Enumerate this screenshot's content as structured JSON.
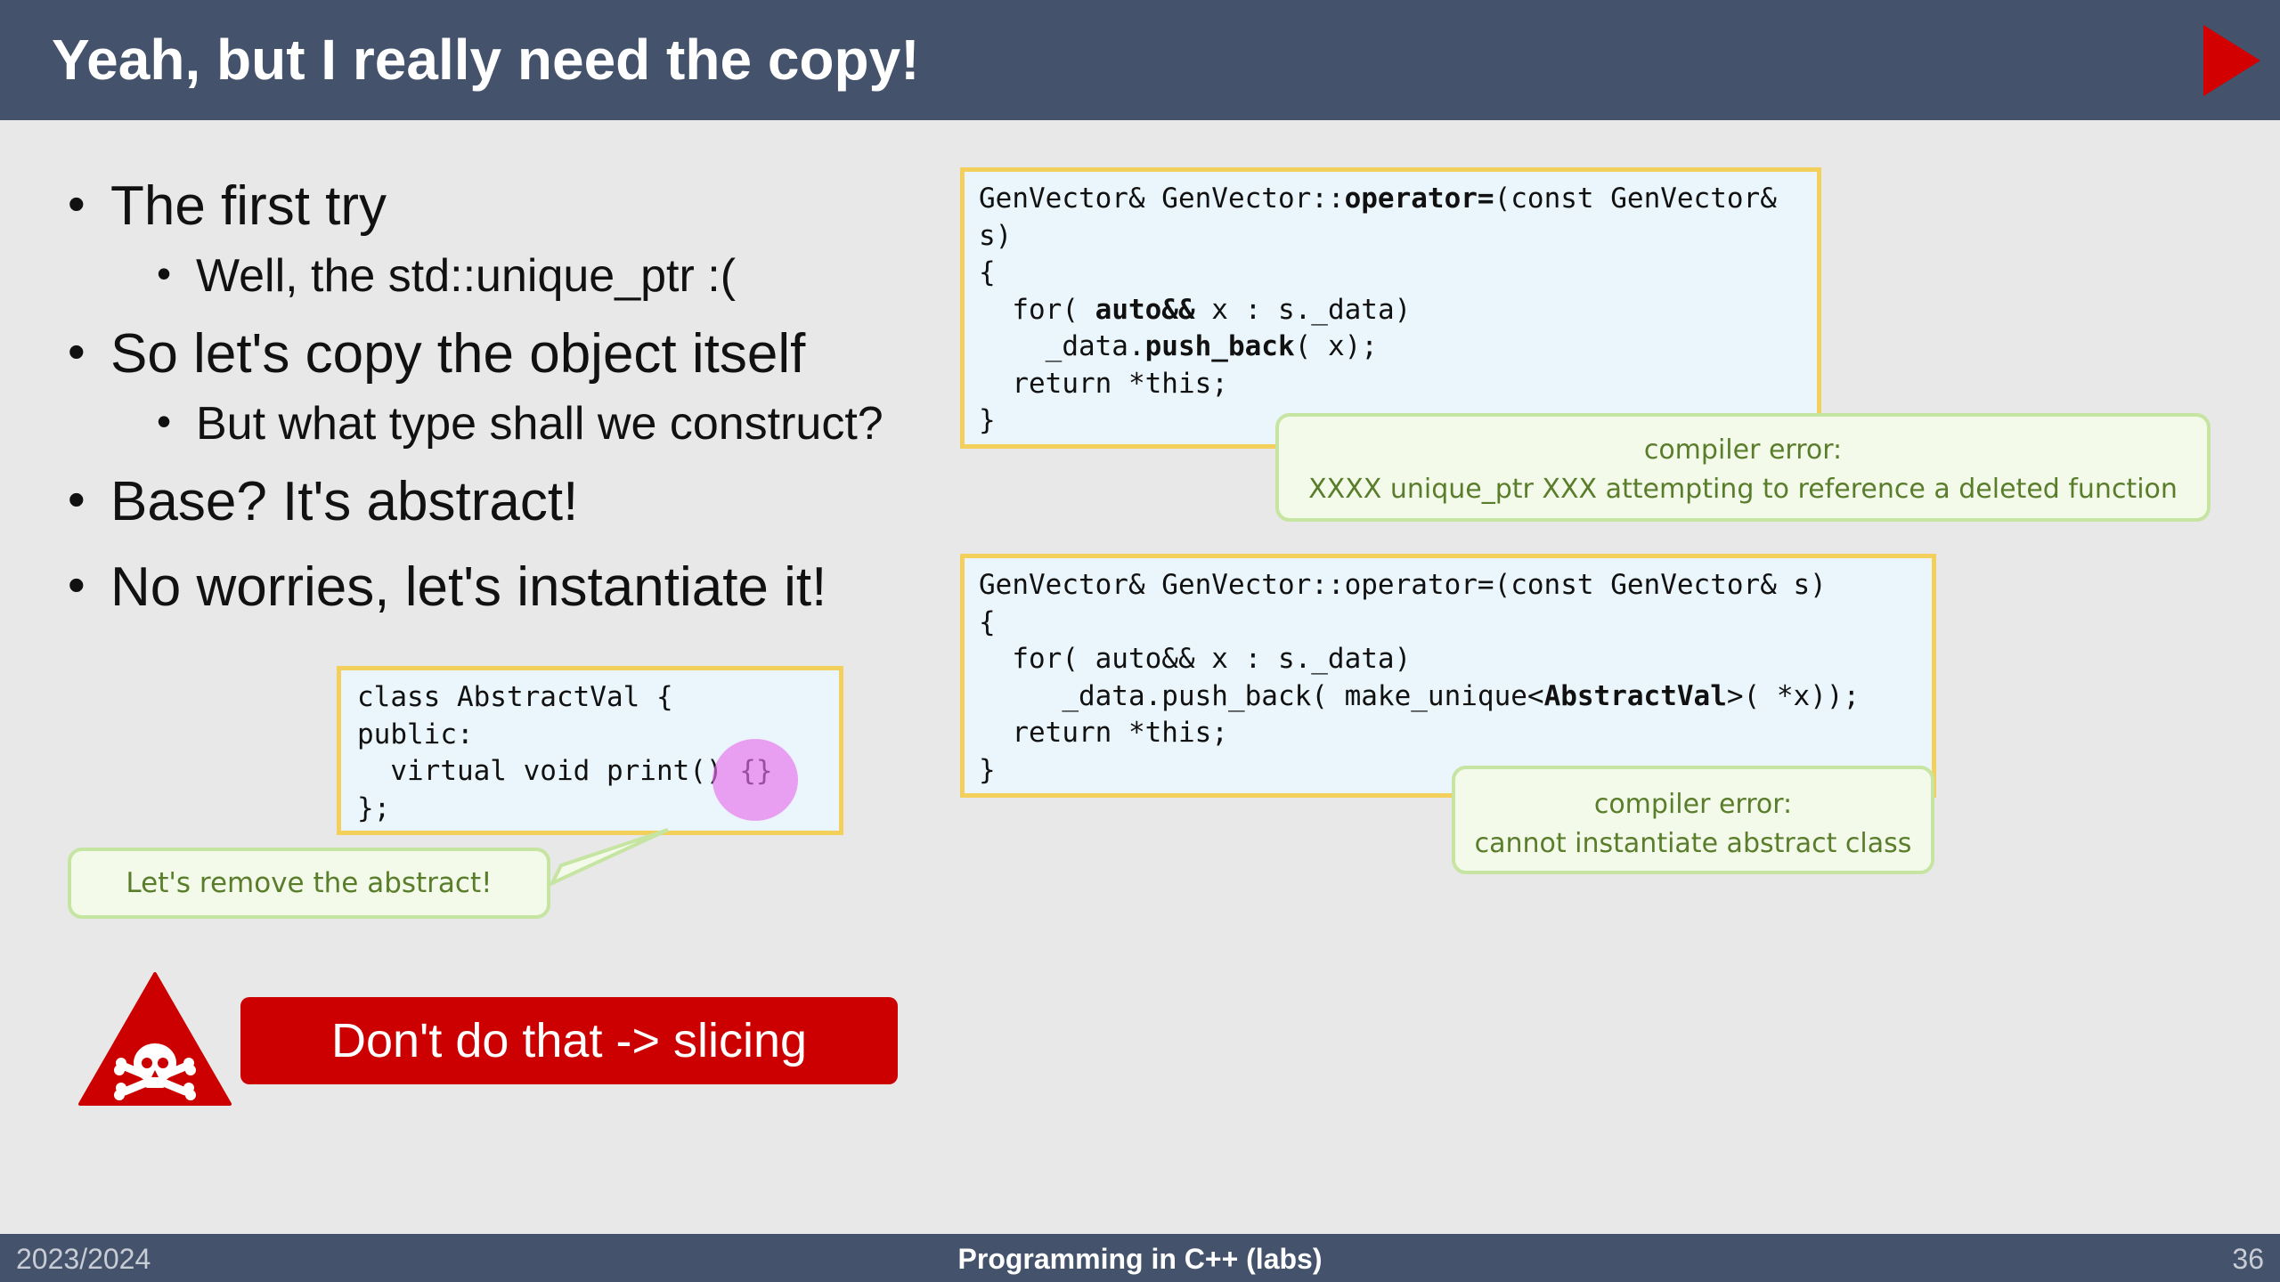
{
  "header": {
    "title": "Yeah, but I really need the copy!",
    "nav_icon": "play-triangle-icon",
    "accent_color": "#d20000",
    "bar_color": "#44536b"
  },
  "bullets": [
    {
      "text": "The first try",
      "level": 1
    },
    {
      "text": "Well, the std::unique_ptr :(",
      "level": 2
    },
    {
      "text": "So let's copy the object itself",
      "level": 1
    },
    {
      "text": "But what type shall we construct?",
      "level": 2
    },
    {
      "text": "Base? It's abstract!",
      "level": 1
    },
    {
      "text": "No worries, let's instantiate it!",
      "level": 1
    }
  ],
  "code_first": {
    "l1a": "GenVector& GenVector::",
    "l1b": "operator=",
    "l1c": "(const GenVector&",
    "l2": "s)",
    "l3": "{",
    "l4a": "  for( ",
    "l4b": "auto&&",
    "l4c": " x : s._data)",
    "l5a": "    _data.",
    "l5b": "push_back",
    "l5c": "( x);",
    "l6": "  return *this;",
    "l7": "}"
  },
  "callout_first": {
    "title": "compiler error:",
    "message": "XXXX unique_ptr XXX attempting to reference a deleted function"
  },
  "code_second": {
    "l1": "GenVector& GenVector::operator=(const GenVector& s)",
    "l2": "{",
    "l3": "  for( auto&& x : s._data)",
    "l4a": "     _data.push_back( make_unique<",
    "l4b": "AbstractVal",
    "l4c": ">( *x));",
    "l5": "  return *this;",
    "l6": "}"
  },
  "callout_second": {
    "title": "compiler error:",
    "message": "cannot instantiate abstract class"
  },
  "code_class": {
    "l1": "class AbstractVal {",
    "l2": "public:",
    "l3": "  virtual void print() {}",
    "l4": "};"
  },
  "callout_class": {
    "message": "Let's remove the abstract!"
  },
  "warning": {
    "icon": "skull-crossbones-warning-icon",
    "text": "Don't do that -> slicing",
    "color": "#cc0000"
  },
  "footer": {
    "left": "2023/2024",
    "center": "Programming in C++ (labs)",
    "right": "36"
  }
}
